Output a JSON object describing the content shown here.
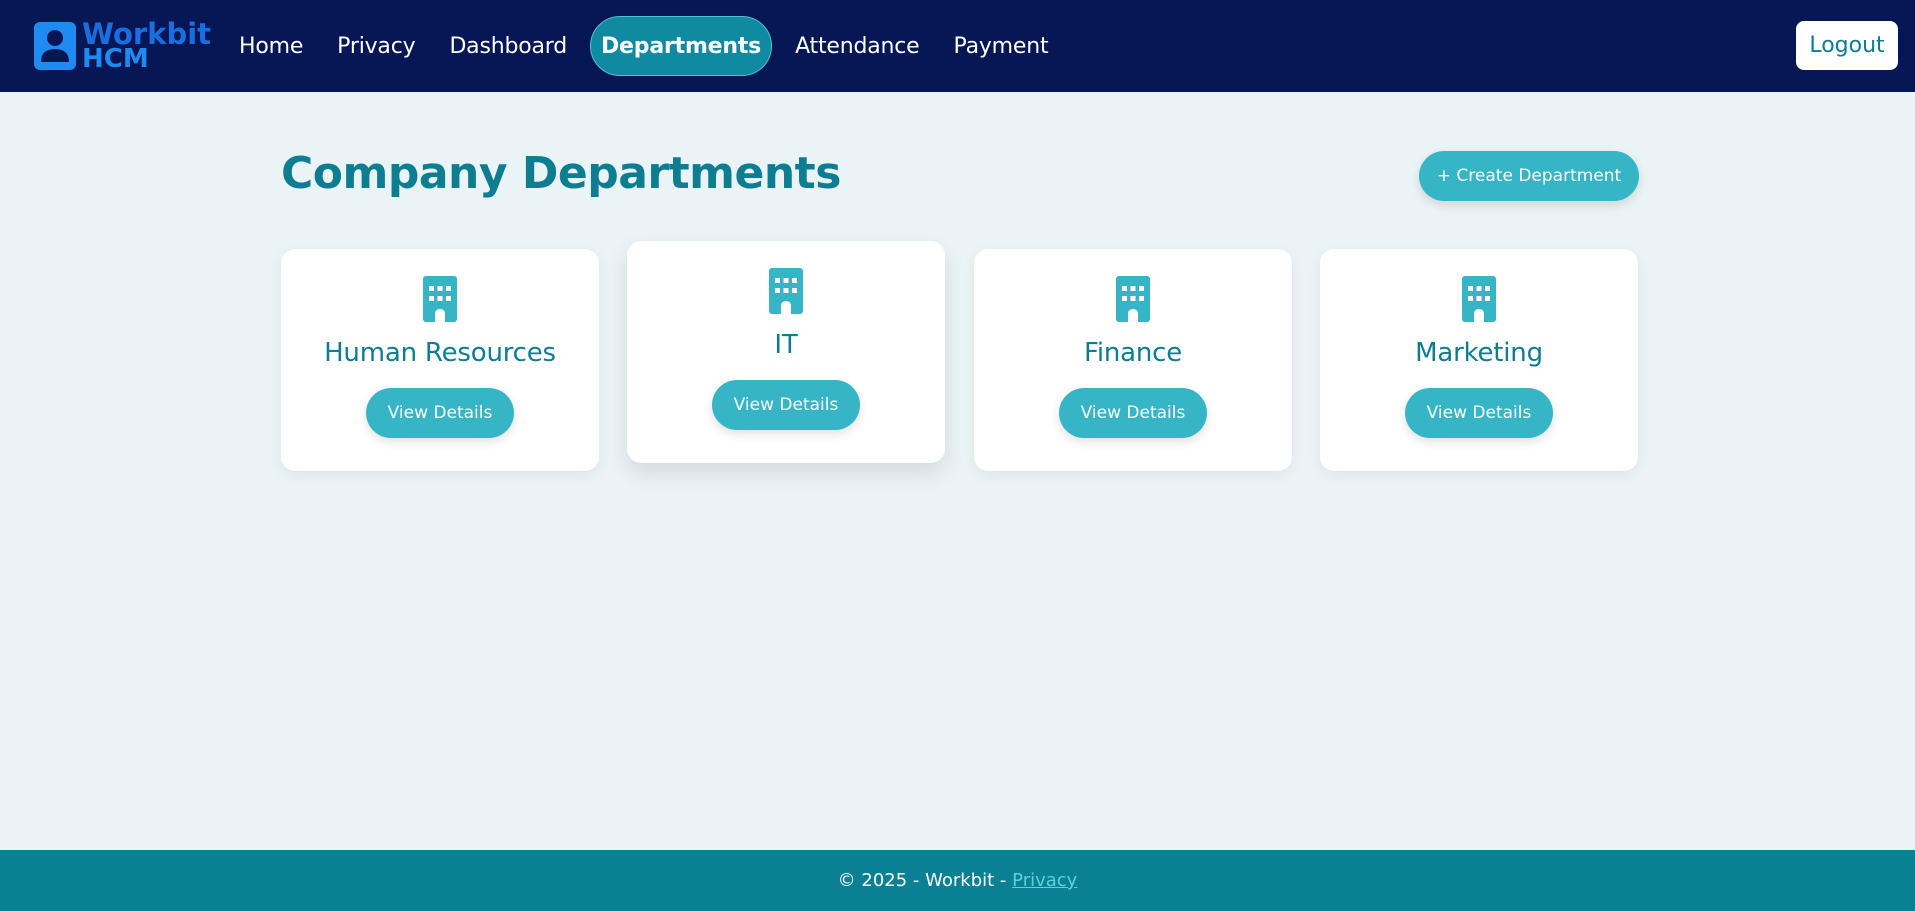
{
  "brand": {
    "line1": "Workbit",
    "line2": "HCM",
    "icon": "user-badge-icon"
  },
  "nav": {
    "items": [
      {
        "label": "Home",
        "active": false
      },
      {
        "label": "Privacy",
        "active": false
      },
      {
        "label": "Dashboard",
        "active": false
      },
      {
        "label": "Departments",
        "active": true
      },
      {
        "label": "Attendance",
        "active": false
      },
      {
        "label": "Payment",
        "active": false
      }
    ],
    "logout_label": "Logout"
  },
  "main": {
    "title": "Company Departments",
    "create_label": "+ Create Department",
    "departments": [
      {
        "name": "Human Resources",
        "button": "View Details",
        "icon": "building-icon"
      },
      {
        "name": "IT",
        "button": "View Details",
        "icon": "building-icon"
      },
      {
        "name": "Finance",
        "button": "View Details",
        "icon": "building-icon"
      },
      {
        "name": "Marketing",
        "button": "View Details",
        "icon": "building-icon"
      }
    ]
  },
  "footer": {
    "text": "© 2025 - Workbit - ",
    "link_label": "Privacy"
  },
  "colors": {
    "navbar": "#071756",
    "accent": "#36b5c6",
    "title": "#0d7d92",
    "footer": "#0a8094",
    "background": "#eaf3f6"
  }
}
